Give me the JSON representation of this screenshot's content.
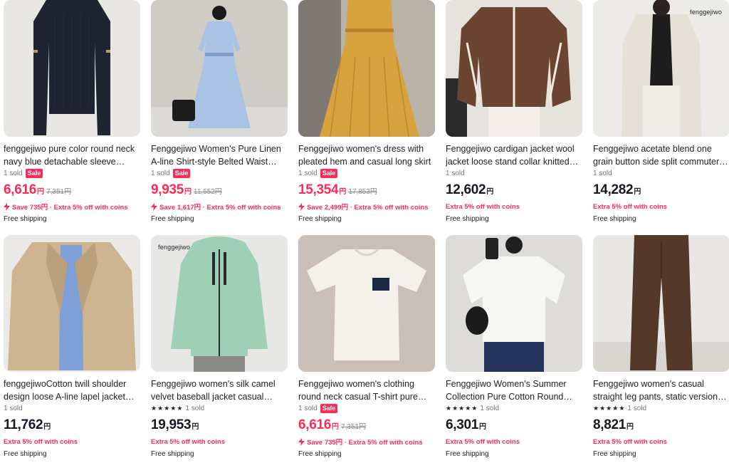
{
  "currency_suffix": "円",
  "products": [
    {
      "title": "fenggejiwo pure color round neck navy blue detachable sleeve sweat…",
      "sold": "1 sold",
      "sale_badge": "Sale",
      "rating": false,
      "price": "6,616",
      "price_red": true,
      "original_price": "7,351円",
      "promo": "Save 735円 · Extra 5% off with coins",
      "promo_bolt": true,
      "shipping": "Free shipping",
      "watermark": "",
      "colors": {
        "bg": "#e9e7e4",
        "item": "#1f2433",
        "accent": "#2a3044"
      }
    },
    {
      "title": "Fenggejiwo Women's Pure Linen A-line Shirt-style Belted Waist Dress…",
      "sold": "1 sold",
      "sale_badge": "Sale",
      "rating": false,
      "price": "9,935",
      "price_red": true,
      "original_price": "11,552円",
      "promo": "Save 1,617円 · Extra 5% off with coins",
      "promo_bolt": true,
      "shipping": "Free shipping",
      "watermark": "",
      "colors": {
        "bg": "#dcdad6",
        "item": "#a9c3e4",
        "accent": "#7f9fca"
      }
    },
    {
      "title": "Fenggejiwo women's dress with pleated hem and casual long skirt",
      "sold": "1 sold",
      "sale_badge": "Sale",
      "rating": false,
      "price": "15,354",
      "price_red": true,
      "original_price": "17,853円",
      "promo": "Save 2,499円 · Extra 5% off with coins",
      "promo_bolt": true,
      "shipping": "Free shipping",
      "watermark": "",
      "colors": {
        "bg": "#b9b2a6",
        "item": "#d8a23e",
        "accent": "#b8822a"
      }
    },
    {
      "title": "Fenggejiwo cardigan jacket wool jacket loose stand collar knitted…",
      "sold": "1 sold",
      "sale_badge": "",
      "rating": false,
      "price": "12,602",
      "price_red": false,
      "original_price": "",
      "promo": "Extra 5% off with coins",
      "promo_bolt": false,
      "shipping": "Free shipping",
      "watermark": "",
      "colors": {
        "bg": "#e6e2dc",
        "item": "#6b4532",
        "accent": "#f0ebe3"
      }
    },
    {
      "title": "Fenggejiwo acetate blend one grain button side split commuter suit…",
      "sold": "1 sold",
      "sale_badge": "",
      "rating": false,
      "price": "14,282",
      "price_red": false,
      "original_price": "",
      "promo": "Extra 5% off with coins",
      "promo_bolt": false,
      "shipping": "Free shipping",
      "watermark": "fenggejiwo",
      "colors": {
        "bg": "#ecebe8",
        "item": "#e6e1d6",
        "accent": "#1d1d1d"
      }
    },
    {
      "title": "fenggejiwoCotton twill shoulder design loose A-line lapel jacket…",
      "sold": "1 sold",
      "sale_badge": "",
      "rating": false,
      "price": "11,762",
      "price_red": false,
      "original_price": "",
      "promo": "Extra 5% off with coins",
      "promo_bolt": false,
      "shipping": "Free shipping",
      "watermark": "",
      "colors": {
        "bg": "#ebe9e5",
        "item": "#cdb592",
        "accent": "#7ea0d6"
      }
    },
    {
      "title": "Fenggejiwo women's silk camel velvet baseball jacket casual silk…",
      "sold": "1 sold",
      "sale_badge": "",
      "rating": true,
      "price": "19,953",
      "price_red": false,
      "original_price": "",
      "promo": "Extra 5% off with coins",
      "promo_bolt": false,
      "shipping": "Free shipping",
      "watermark": "fenggejiwo",
      "colors": {
        "bg": "#e7e7e5",
        "item": "#9fd0b5",
        "accent": "#2a2a2a"
      }
    },
    {
      "title": "Fenggejiwo women's clothing round neck casual T-shirt pure cotton…",
      "sold": "1 sold",
      "sale_badge": "Sale",
      "rating": false,
      "price": "6,616",
      "price_red": true,
      "original_price": "7,351円",
      "promo": "Save 735円 · Extra 5% off with coins",
      "promo_bolt": true,
      "shipping": "Free shipping",
      "watermark": "",
      "colors": {
        "bg": "#c9c1b8",
        "item": "#f4f1ea",
        "accent": "#1e2740"
      }
    },
    {
      "title": "Fenggejiwo Women's Summer Collection Pure Cotton Round Nec…",
      "sold": "1 sold",
      "sale_badge": "",
      "rating": true,
      "price": "6,301",
      "price_red": false,
      "original_price": "",
      "promo": "Extra 5% off with coins",
      "promo_bolt": false,
      "shipping": "Free shipping",
      "watermark": "",
      "colors": {
        "bg": "#dedcd8",
        "item": "#f6f6f4",
        "accent": "#24345c"
      }
    },
    {
      "title": "Fenggejiwo women's casual straight leg pants, static version pants,…",
      "sold": "1 sold",
      "sale_badge": "",
      "rating": true,
      "price": "8,821",
      "price_red": false,
      "original_price": "",
      "promo": "Extra 5% off with coins",
      "promo_bolt": false,
      "shipping": "Free shipping",
      "watermark": "",
      "colors": {
        "bg": "#e9e7e3",
        "item": "#54392a",
        "accent": "#3f2a1f"
      }
    }
  ]
}
